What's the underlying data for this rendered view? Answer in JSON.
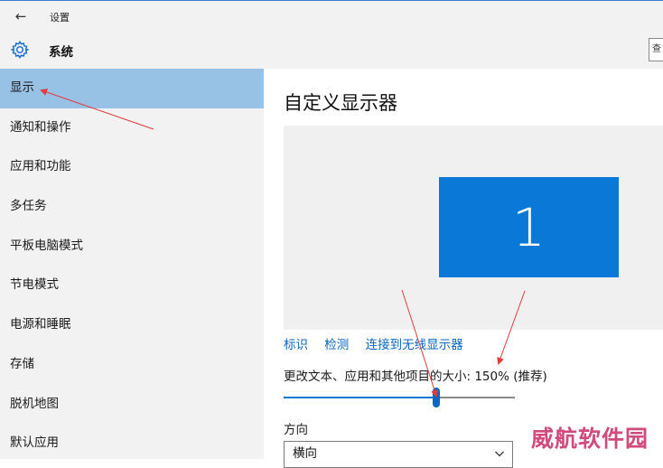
{
  "window": {
    "title": "设置",
    "back_glyph": "←"
  },
  "header": {
    "title": "系统",
    "search_stub": "查"
  },
  "sidebar": {
    "items": [
      {
        "label": "显示",
        "active": true
      },
      {
        "label": "通知和操作"
      },
      {
        "label": "应用和功能"
      },
      {
        "label": "多任务"
      },
      {
        "label": "平板电脑模式"
      },
      {
        "label": "节电模式"
      },
      {
        "label": "电源和睡眠"
      },
      {
        "label": "存储"
      },
      {
        "label": "脱机地图"
      },
      {
        "label": "默认应用"
      }
    ]
  },
  "main": {
    "title": "自定义显示器",
    "monitor_label": "1",
    "links": {
      "identify": "标识",
      "detect": "检测",
      "connect": "连接到无线显示器"
    },
    "scale_label": "更改文本、应用和其他项目的大小: 150% (推荐)",
    "scale_fraction": 0.66,
    "orientation": {
      "label": "方向",
      "value": "横向"
    }
  },
  "watermark": "威航软件园",
  "colors": {
    "accent": "#0a78d7",
    "sidebar_active": "#98c1e6",
    "sidebar_bg": "#f2f2f2",
    "link": "#0a66c2",
    "annotation_arrow": "#e23b3b",
    "watermark": "#d04a7a"
  },
  "icons": {
    "back": "arrow-left-icon",
    "section": "gear-icon",
    "dropdown": "chevron-down-icon"
  }
}
